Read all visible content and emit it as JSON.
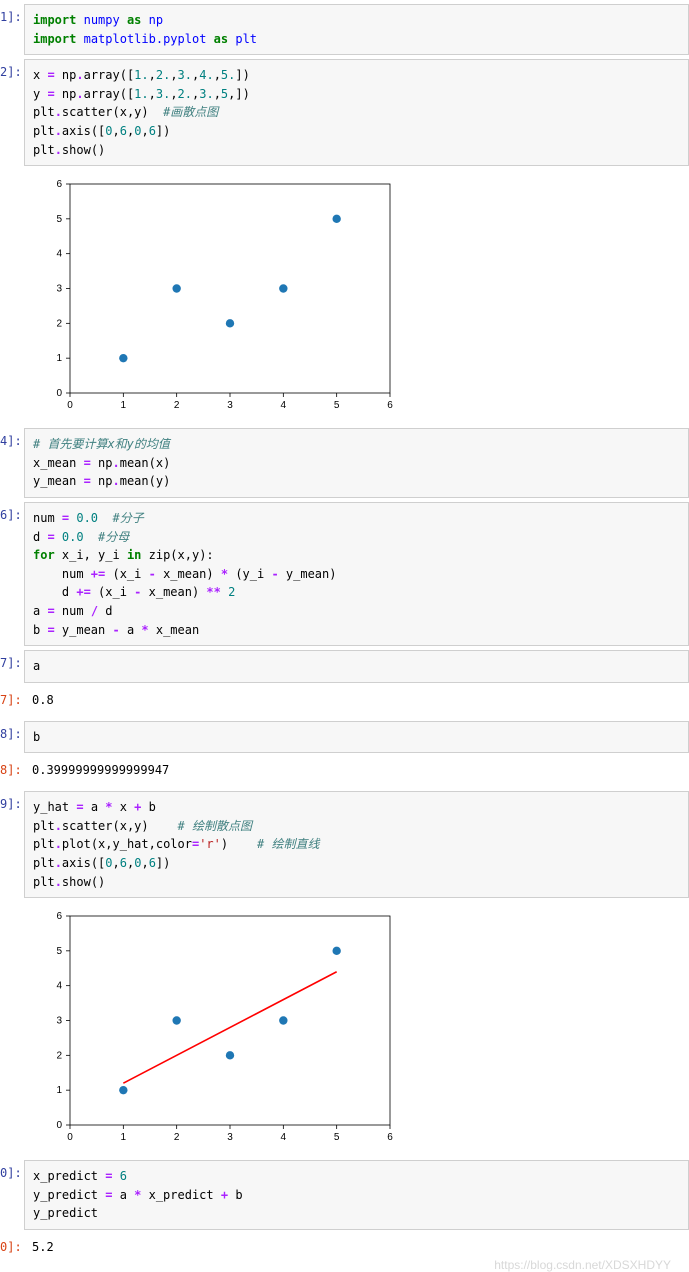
{
  "cells": {
    "c1": {
      "prompt": "1]:"
    },
    "c2": {
      "prompt": "2]:"
    },
    "c4": {
      "prompt": "4]:"
    },
    "c6": {
      "prompt": "6]:"
    },
    "c7a": {
      "prompt": "7]:",
      "code": "a"
    },
    "c7b": {
      "prompt": "7]:",
      "output": "0.8"
    },
    "c8a": {
      "prompt": "8]:",
      "code": "b"
    },
    "c8b": {
      "prompt": "8]:",
      "output": "0.39999999999999947"
    },
    "c9": {
      "prompt": "9]:"
    },
    "c0a": {
      "prompt": "0]:"
    },
    "c0b": {
      "prompt": "0]:",
      "output": "5.2"
    }
  },
  "code": {
    "c1_import1_kw": "import",
    "c1_import1_mod": "numpy",
    "c1_import1_as": "as",
    "c1_import1_alias": "np",
    "c1_import2_kw": "import",
    "c1_import2_mod": "matplotlib.pyplot",
    "c1_import2_as": "as",
    "c1_import2_alias": "plt",
    "c2_l1_a": "x ",
    "c2_l1_eq": "= ",
    "c2_l1_b": "np",
    "c2_l1_c": ".array([",
    "c2_l1_n1": "1.",
    "c2_l1_n2": "2.",
    "c2_l1_n3": "3.",
    "c2_l1_n4": "4.",
    "c2_l1_n5": "5.",
    "c2_l1_d": "])",
    "c2_l2_a": "y ",
    "c2_l2_eq": "= ",
    "c2_l2_b": "np",
    "c2_l2_c": ".array([",
    "c2_l2_n1": "1.",
    "c2_l2_n2": "3.",
    "c2_l2_n3": "2.",
    "c2_l2_n4": "3.",
    "c2_l2_n5": "5",
    "c2_l2_d": ",])",
    "c2_l3_a": "plt",
    "c2_l3_b": ".scatter(x,y)  ",
    "c2_l3_cmt": "#画散点图",
    "c2_l4_a": "plt",
    "c2_l4_b": ".axis([",
    "c2_l4_n1": "0",
    "c2_l4_n2": "6",
    "c2_l4_n3": "0",
    "c2_l4_n4": "6",
    "c2_l4_c": "])",
    "c2_l5_a": "plt",
    "c2_l5_b": ".show()",
    "c4_l1": "# 首先要计算x和y的均值",
    "c4_l2_a": "x_mean ",
    "c4_l2_eq": "= ",
    "c4_l2_b": "np",
    "c4_l2_c": ".mean(x)",
    "c4_l3_a": "y_mean ",
    "c4_l3_eq": "= ",
    "c4_l3_b": "np",
    "c4_l3_c": ".mean(y)",
    "c6_l1_a": "num ",
    "c6_l1_eq": "= ",
    "c6_l1_n": "0.0",
    "c6_l1_s": "  ",
    "c6_l1_cmt": "#分子",
    "c6_l2_a": "d ",
    "c6_l2_eq": "= ",
    "c6_l2_n": "0.0",
    "c6_l2_s": "  ",
    "c6_l2_cmt": "#分母",
    "c6_l3_for": "for",
    "c6_l3_v": " x_i, y_i ",
    "c6_l3_in": "in",
    "c6_l3_rest": " zip(x,y):",
    "c6_l4_a": "    num ",
    "c6_l4_op": "+= ",
    "c6_l4_b": "(x_i ",
    "c6_l4_m1": "- ",
    "c6_l4_c": "x_mean) ",
    "c6_l4_m2": "* ",
    "c6_l4_d": "(y_i ",
    "c6_l4_m3": "- ",
    "c6_l4_e": "y_mean)",
    "c6_l5_a": "    d ",
    "c6_l5_op": "+= ",
    "c6_l5_b": "(x_i ",
    "c6_l5_m1": "- ",
    "c6_l5_c": "x_mean) ",
    "c6_l5_pw": "** ",
    "c6_l5_n": "2",
    "c6_l6_a": "a ",
    "c6_l6_eq": "= ",
    "c6_l6_b": "num ",
    "c6_l6_op": "/ ",
    "c6_l6_c": "d",
    "c6_l7_a": "b ",
    "c6_l7_eq": "= ",
    "c6_l7_b": "y_mean ",
    "c6_l7_op": "- ",
    "c6_l7_c": "a ",
    "c6_l7_op2": "* ",
    "c6_l7_d": "x_mean",
    "c9_l1_a": "y_hat ",
    "c9_l1_eq": "= ",
    "c9_l1_b": "a ",
    "c9_l1_op": "* ",
    "c9_l1_c": "x ",
    "c9_l1_op2": "+ ",
    "c9_l1_d": "b",
    "c9_l2_a": "plt",
    "c9_l2_b": ".scatter(x,y)    ",
    "c9_l2_cmt": "# 绘制散点图",
    "c9_l3_a": "plt",
    "c9_l3_b": ".plot(x,y_hat,color",
    "c9_l3_eq": "=",
    "c9_l3_s": "'r'",
    "c9_l3_c": ")    ",
    "c9_l3_cmt": "# 绘制直线",
    "c9_l4_a": "plt",
    "c9_l4_b": ".axis([",
    "c9_l4_n1": "0",
    "c9_l4_n2": "6",
    "c9_l4_n3": "0",
    "c9_l4_n4": "6",
    "c9_l4_c": "])",
    "c9_l5_a": "plt",
    "c9_l5_b": ".show()",
    "c0_l1_a": "x_predict ",
    "c0_l1_eq": "= ",
    "c0_l1_n": "6",
    "c0_l2_a": "y_predict ",
    "c0_l2_eq": "= ",
    "c0_l2_b": "a ",
    "c0_l2_op": "* ",
    "c0_l2_c": "x_predict ",
    "c0_l2_op2": "+ ",
    "c0_l2_d": "b",
    "c0_l3": "y_predict"
  },
  "watermark": "https://blog.csdn.net/XDSXHDYY",
  "chart_data": [
    {
      "type": "scatter",
      "x": [
        1,
        2,
        3,
        4,
        5
      ],
      "y": [
        1,
        3,
        2,
        3,
        5
      ],
      "xlim": [
        0,
        6
      ],
      "ylim": [
        0,
        6
      ],
      "xticks": [
        0,
        1,
        2,
        3,
        4,
        5,
        6
      ],
      "yticks": [
        0,
        1,
        2,
        3,
        4,
        5,
        6
      ]
    },
    {
      "type": "scatter",
      "x": [
        1,
        2,
        3,
        4,
        5
      ],
      "y": [
        1,
        3,
        2,
        3,
        5
      ],
      "line": {
        "x": [
          1,
          5
        ],
        "y": [
          1.2,
          4.4
        ],
        "color": "r"
      },
      "xlim": [
        0,
        6
      ],
      "ylim": [
        0,
        6
      ],
      "xticks": [
        0,
        1,
        2,
        3,
        4,
        5,
        6
      ],
      "yticks": [
        0,
        1,
        2,
        3,
        4,
        5,
        6
      ]
    }
  ]
}
